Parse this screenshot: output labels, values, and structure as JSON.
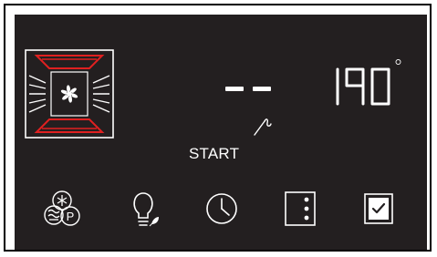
{
  "display": {
    "timer_value": "- -",
    "temperature": "190",
    "degree_symbol": "°",
    "start_label": "START"
  },
  "mode_icon": "fan-convection-top-bottom-heat-icon",
  "probe_icon": "meat-probe-icon",
  "buttons": [
    {
      "id": "mode",
      "icon": "fan-and-p-programs-icon"
    },
    {
      "id": "light",
      "icon": "lightbulb-icon"
    },
    {
      "id": "timer",
      "icon": "clock-icon"
    },
    {
      "id": "menu",
      "icon": "vertical-dots-menu-icon"
    },
    {
      "id": "confirm",
      "icon": "checkbox-check-icon"
    }
  ],
  "colors": {
    "panel": "#231f20",
    "foreground": "#ffffff",
    "heating_element": "#e02020"
  }
}
